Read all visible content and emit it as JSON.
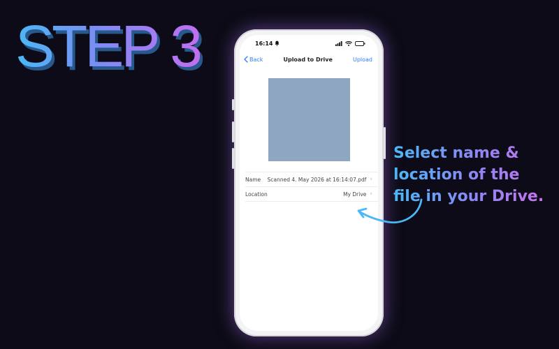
{
  "heading": "STEP 3",
  "phone": {
    "status": {
      "time": "16:14"
    },
    "nav": {
      "back_label": "Back",
      "title": "Upload to Drive",
      "action_label": "Upload"
    },
    "preview_color": "#8ea6bf",
    "fields": [
      {
        "label": "Name",
        "value": "Scanned 4. May 2026 at 16:14:07.pdf"
      },
      {
        "label": "Location",
        "value": "My Drive"
      }
    ]
  },
  "callout": {
    "lines": [
      "Select name &",
      "location of the",
      "file in your Drive."
    ]
  },
  "colors": {
    "background": "#0d0b17",
    "gradient_start": "#4ab8f6",
    "gradient_end": "#c873ee",
    "ios_accent": "#2f7cf6"
  }
}
